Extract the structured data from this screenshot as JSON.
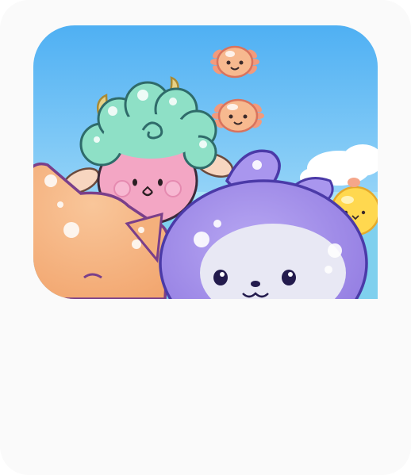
{
  "app_card": {
    "icon": "cute-animal-characters-app-icon",
    "colors": {
      "card_background": "#fafafa",
      "sky_top": "#5bb8f5",
      "sky_bottom": "#a6dcf9",
      "sheep_wool": "#8ee0c6",
      "sheep_face": "#f4a6c4",
      "cat_body": "#f5b27a",
      "seal_body": "#9a86e8",
      "axolotl": "#f6b48e",
      "chick": "#ffd54a"
    },
    "app_name": ""
  }
}
